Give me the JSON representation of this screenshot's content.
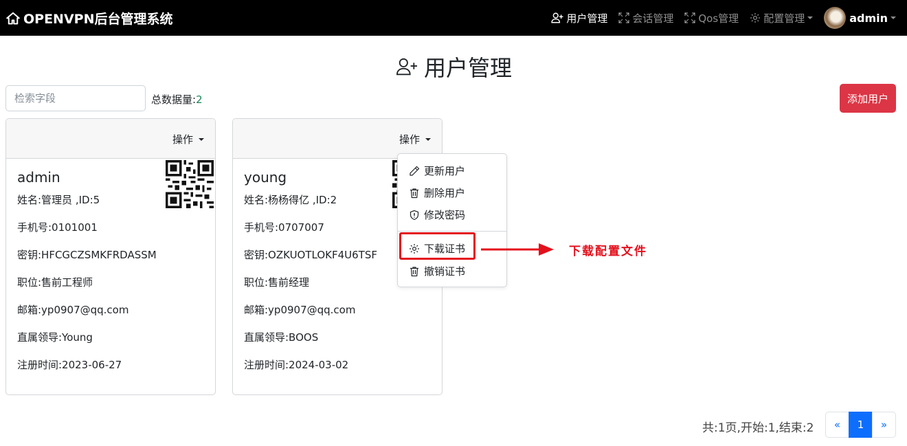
{
  "app": {
    "title": "OPENVPN后台管理系统",
    "brand_icon": "house-icon"
  },
  "nav": {
    "items": [
      {
        "label": "用户管理",
        "icon": "person-plus-icon",
        "active": true
      },
      {
        "label": "会话管理",
        "icon": "fullscreen-icon",
        "active": false
      },
      {
        "label": "Qos管理",
        "icon": "fullscreen-icon",
        "active": false
      },
      {
        "label": "配置管理",
        "icon": "gear-icon",
        "active": false,
        "dropdown": true
      }
    ],
    "user": "admin"
  },
  "page": {
    "title": "用户管理",
    "title_icon": "person-plus-icon"
  },
  "toolbar": {
    "search_placeholder": "检索字段",
    "total_label": "总数据量:",
    "total_value": "2",
    "add_label": "添加用户"
  },
  "users": [
    {
      "ops_label": "操作",
      "username": "admin",
      "name": "姓名:管理员 ,ID:5",
      "phone": "手机号:0101001",
      "secret": "密钥:HFCGCZSMKFRDASSM",
      "position": "职位:售前工程师",
      "email": "邮箱:yp0907@qq.com",
      "leader": "直属领导:Young",
      "registered": "注册时间:2023-06-27"
    },
    {
      "ops_label": "操作",
      "username": "young",
      "name": "姓名:杨杨得亿 ,ID:2",
      "phone": "手机号:0707007",
      "secret": "密钥:OZKUOTLOKF4U6TSF",
      "position": "职位:售前经理",
      "email": "邮箱:yp0907@qq.com",
      "leader": "直属领导:BOOS",
      "registered": "注册时间:2024-03-02"
    }
  ],
  "dropdown_menu": {
    "items": [
      {
        "label": "更新用户",
        "icon": "pencil-icon"
      },
      {
        "label": "删除用户",
        "icon": "trash-icon"
      },
      {
        "label": "修改密码",
        "icon": "shield-icon"
      },
      {
        "label": "下载证书",
        "icon": "gear-icon"
      },
      {
        "label": "撤销证书",
        "icon": "trash-icon"
      }
    ]
  },
  "annotation": {
    "text": "下载配置文件",
    "color": "#e4101c"
  },
  "pagination": {
    "info": "共:1页,开始:1,结束:2",
    "prev": "«",
    "current": "1",
    "next": "»"
  },
  "colors": {
    "navbar": "#000000",
    "danger": "#dc3545",
    "primary": "#0d6efd",
    "success": "#198754"
  }
}
